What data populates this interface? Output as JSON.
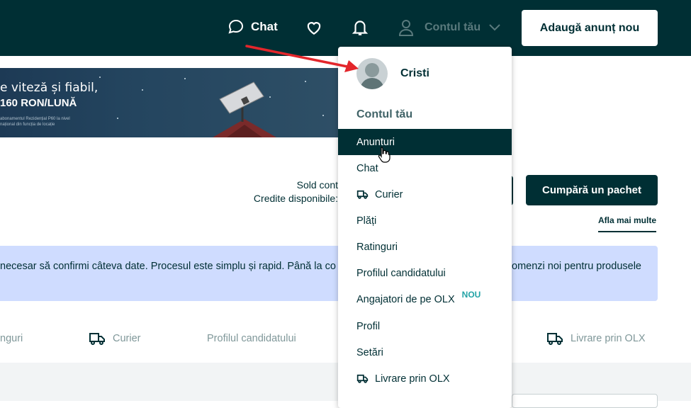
{
  "header": {
    "chat_label": "Chat",
    "account_label": "Contul tău",
    "add_button": "Adaugă anunț nou",
    "icons": [
      "chat-bubble-icon",
      "heart-icon",
      "bell-icon",
      "user-icon",
      "chevron-down-icon"
    ]
  },
  "banner": {
    "line1": "e viteză și fiabil,",
    "line2": "160 RON/LUNĂ",
    "fineprint": "abonamentul Rezidențial P60 la nivel național din funcția de locație"
  },
  "account": {
    "sold_label": "Sold cont",
    "credits_label": "Credite disponibile:",
    "buy_button": "Cumpără un pachet",
    "more_link": "Afla mai multe"
  },
  "info": {
    "text_left": "necesar să confirmi câteva date. Procesul este simplu și rapid. Până la co",
    "text_right": "omenzi noi pentru produsele"
  },
  "tabs": [
    {
      "label": "nguri"
    },
    {
      "label": "Curier",
      "icon": "truck-icon"
    },
    {
      "label": "Profilul candidatului"
    },
    {
      "label": "Livrare prin OLX",
      "icon": "truck-icon"
    }
  ],
  "dropdown": {
    "user_name": "Cristi",
    "section_title": "Contul tău",
    "items": [
      {
        "label": "Anunturi",
        "active": true
      },
      {
        "label": "Chat"
      },
      {
        "label": "Curier",
        "icon": "truck-icon"
      },
      {
        "label": "Plăți"
      },
      {
        "label": "Ratinguri"
      },
      {
        "label": "Profilul candidatului"
      },
      {
        "label": "Angajatori de pe OLX",
        "badge": "NOU"
      },
      {
        "label": "Profil"
      },
      {
        "label": "Setări"
      },
      {
        "label": "Livrare prin OLX",
        "icon": "truck-icon"
      }
    ]
  },
  "colors": {
    "brand_dark": "#002f34",
    "info_background": "#cfdcff",
    "badge": "#23a3a6",
    "arrow": "#e3262b"
  }
}
